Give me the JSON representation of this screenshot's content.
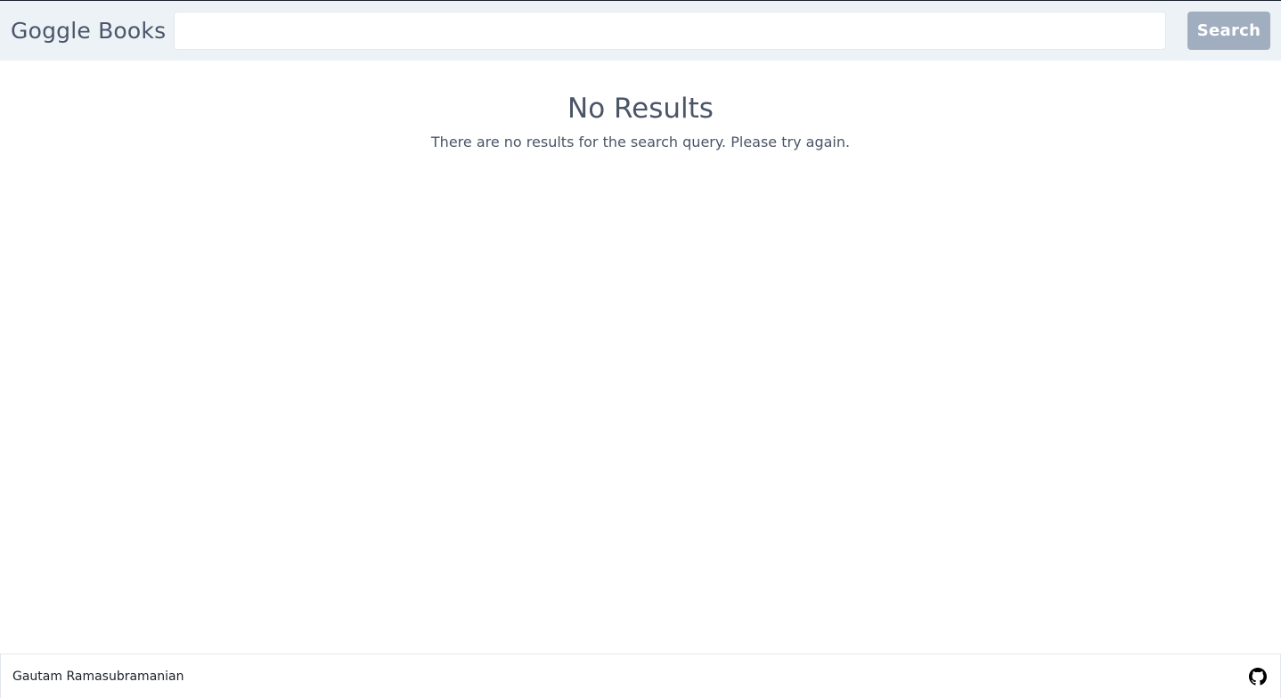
{
  "header": {
    "brand": "Goggle Books",
    "search": {
      "value": "",
      "placeholder": ""
    },
    "search_button_label": "Search"
  },
  "main": {
    "title": "No Results",
    "message": "There are no results for the search query. Please try again."
  },
  "footer": {
    "author": "Gautam Ramasubramanian",
    "github_icon": "github-icon"
  },
  "colors": {
    "header_bg": "#edf2f7",
    "text": "#4a5568",
    "button_bg": "#a0aec0",
    "button_text": "#ffffff"
  }
}
